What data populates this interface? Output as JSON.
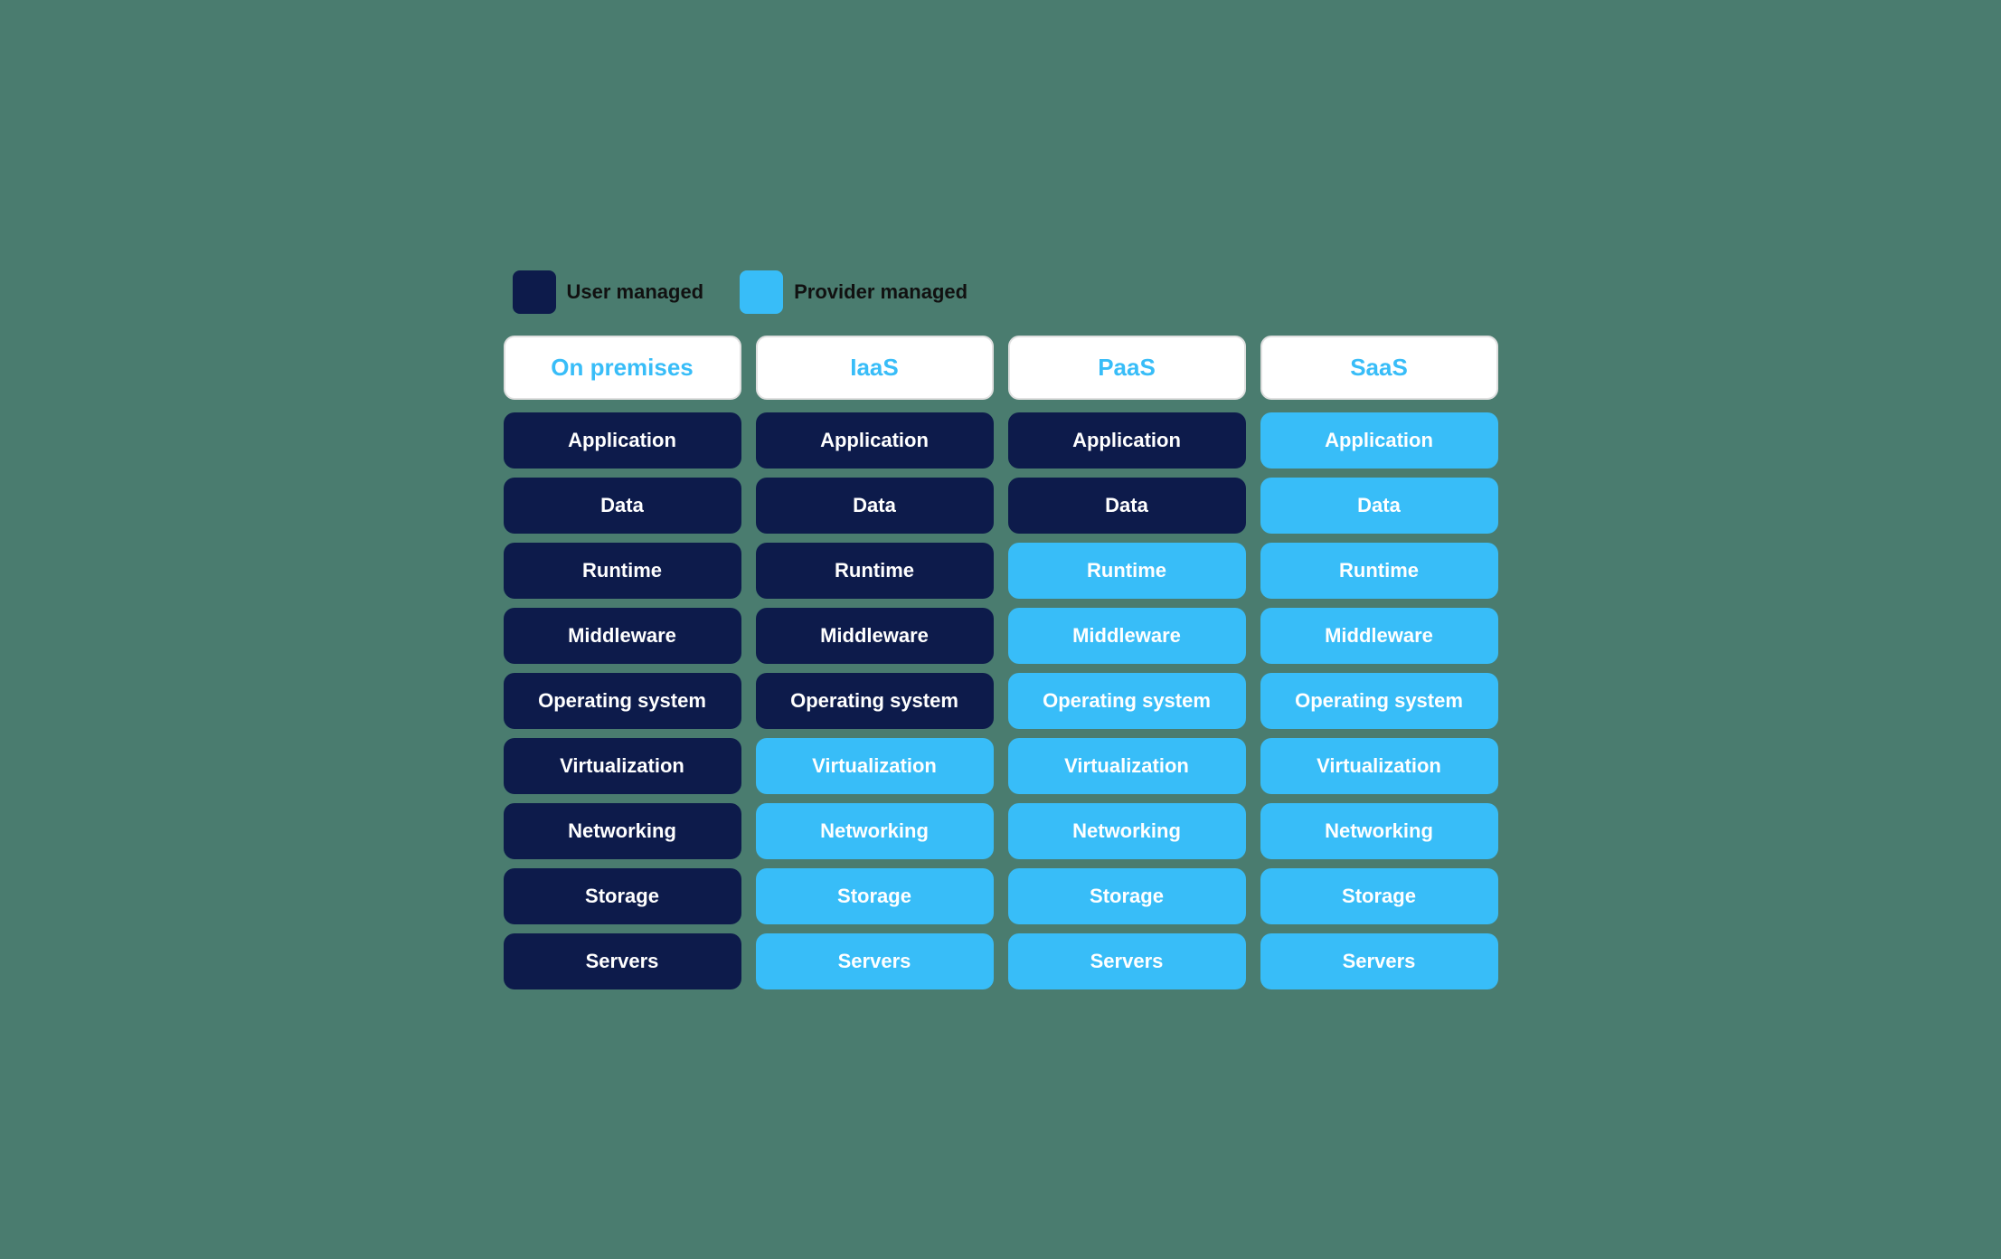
{
  "legend": {
    "user_managed_label": "User managed",
    "provider_managed_label": "Provider managed",
    "user_managed_color": "#0d1b4b",
    "provider_managed_color": "#38bdf8"
  },
  "columns": [
    {
      "id": "on-premises",
      "header": "On premises",
      "rows": [
        {
          "label": "Application",
          "type": "dark"
        },
        {
          "label": "Data",
          "type": "dark"
        },
        {
          "label": "Runtime",
          "type": "dark"
        },
        {
          "label": "Middleware",
          "type": "dark"
        },
        {
          "label": "Operating system",
          "type": "dark"
        },
        {
          "label": "Virtualization",
          "type": "dark"
        },
        {
          "label": "Networking",
          "type": "dark"
        },
        {
          "label": "Storage",
          "type": "dark"
        },
        {
          "label": "Servers",
          "type": "dark"
        }
      ]
    },
    {
      "id": "iaas",
      "header": "IaaS",
      "rows": [
        {
          "label": "Application",
          "type": "dark"
        },
        {
          "label": "Data",
          "type": "dark"
        },
        {
          "label": "Runtime",
          "type": "dark"
        },
        {
          "label": "Middleware",
          "type": "dark"
        },
        {
          "label": "Operating system",
          "type": "dark"
        },
        {
          "label": "Virtualization",
          "type": "light"
        },
        {
          "label": "Networking",
          "type": "light"
        },
        {
          "label": "Storage",
          "type": "light"
        },
        {
          "label": "Servers",
          "type": "light"
        }
      ]
    },
    {
      "id": "paas",
      "header": "PaaS",
      "rows": [
        {
          "label": "Application",
          "type": "dark"
        },
        {
          "label": "Data",
          "type": "dark"
        },
        {
          "label": "Runtime",
          "type": "light"
        },
        {
          "label": "Middleware",
          "type": "light"
        },
        {
          "label": "Operating system",
          "type": "light"
        },
        {
          "label": "Virtualization",
          "type": "light"
        },
        {
          "label": "Networking",
          "type": "light"
        },
        {
          "label": "Storage",
          "type": "light"
        },
        {
          "label": "Servers",
          "type": "light"
        }
      ]
    },
    {
      "id": "saas",
      "header": "SaaS",
      "rows": [
        {
          "label": "Application",
          "type": "light"
        },
        {
          "label": "Data",
          "type": "light"
        },
        {
          "label": "Runtime",
          "type": "light"
        },
        {
          "label": "Middleware",
          "type": "light"
        },
        {
          "label": "Operating system",
          "type": "light"
        },
        {
          "label": "Virtualization",
          "type": "light"
        },
        {
          "label": "Networking",
          "type": "light"
        },
        {
          "label": "Storage",
          "type": "light"
        },
        {
          "label": "Servers",
          "type": "light"
        }
      ]
    }
  ]
}
